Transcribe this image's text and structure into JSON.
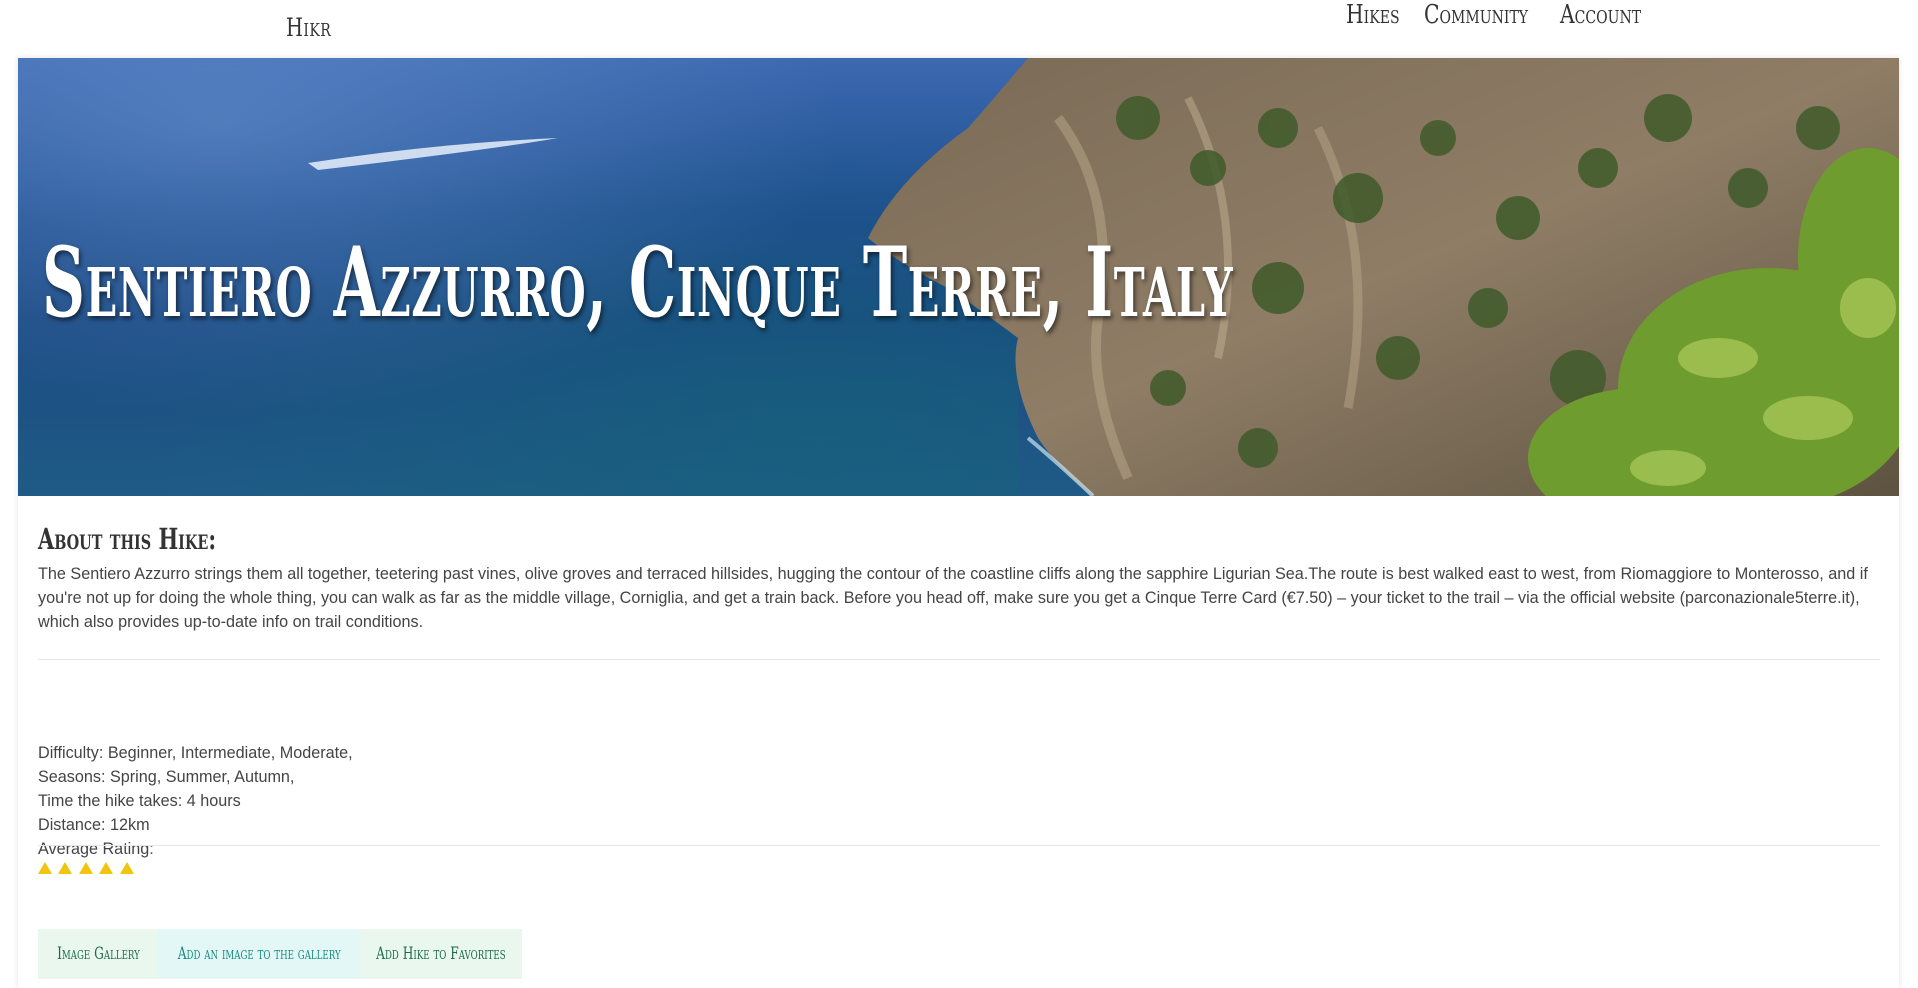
{
  "nav": {
    "brand": "Hikr",
    "links": [
      "Hikes",
      "Community",
      "Account"
    ]
  },
  "hero": {
    "title": "Sentiero Azzurro, Cinque Terre, Italy"
  },
  "about": {
    "heading": "About this Hike:",
    "text": "The Sentiero Azzurro strings them all together, teetering past vines, olive groves and terraced hillsides, hugging the contour of the coastline cliffs along the sapphire Ligurian Sea.The route is best walked east to west, from Riomaggiore to Monterosso, and if you're not up for doing the whole thing, you can walk as far as the middle village, Corniglia, and get a train back. Before you head off, make sure you get a Cinque Terre Card (€7.50) – your ticket to the trail – via the official website (parconazionale5terre.it), which also provides up-to-date info on trail conditions."
  },
  "details": {
    "difficulty": "Difficulty: Beginner, Intermediate, Moderate,",
    "seasons": "Seasons: Spring, Summer, Autumn,",
    "time": "Time the hike takes: 4 hours",
    "distance": "Distance: 12km",
    "rating_label": "Average Rating:",
    "rating_value": 5,
    "rating_max": 5
  },
  "buttons": {
    "gallery": "Image Gallery",
    "add_image": "Add an image to the gallery",
    "favorite": "Add Hike to Favorites"
  },
  "colors": {
    "star": "#f1c40f",
    "btn_gallery_bg": "#e9f7ef",
    "btn_gallery_text": "#1e6b4a",
    "btn_add_bg": "#e3f8f6",
    "btn_add_text": "#17897e",
    "btn_fav_bg": "#e9f7ef",
    "btn_fav_text": "#1e6b4a"
  }
}
